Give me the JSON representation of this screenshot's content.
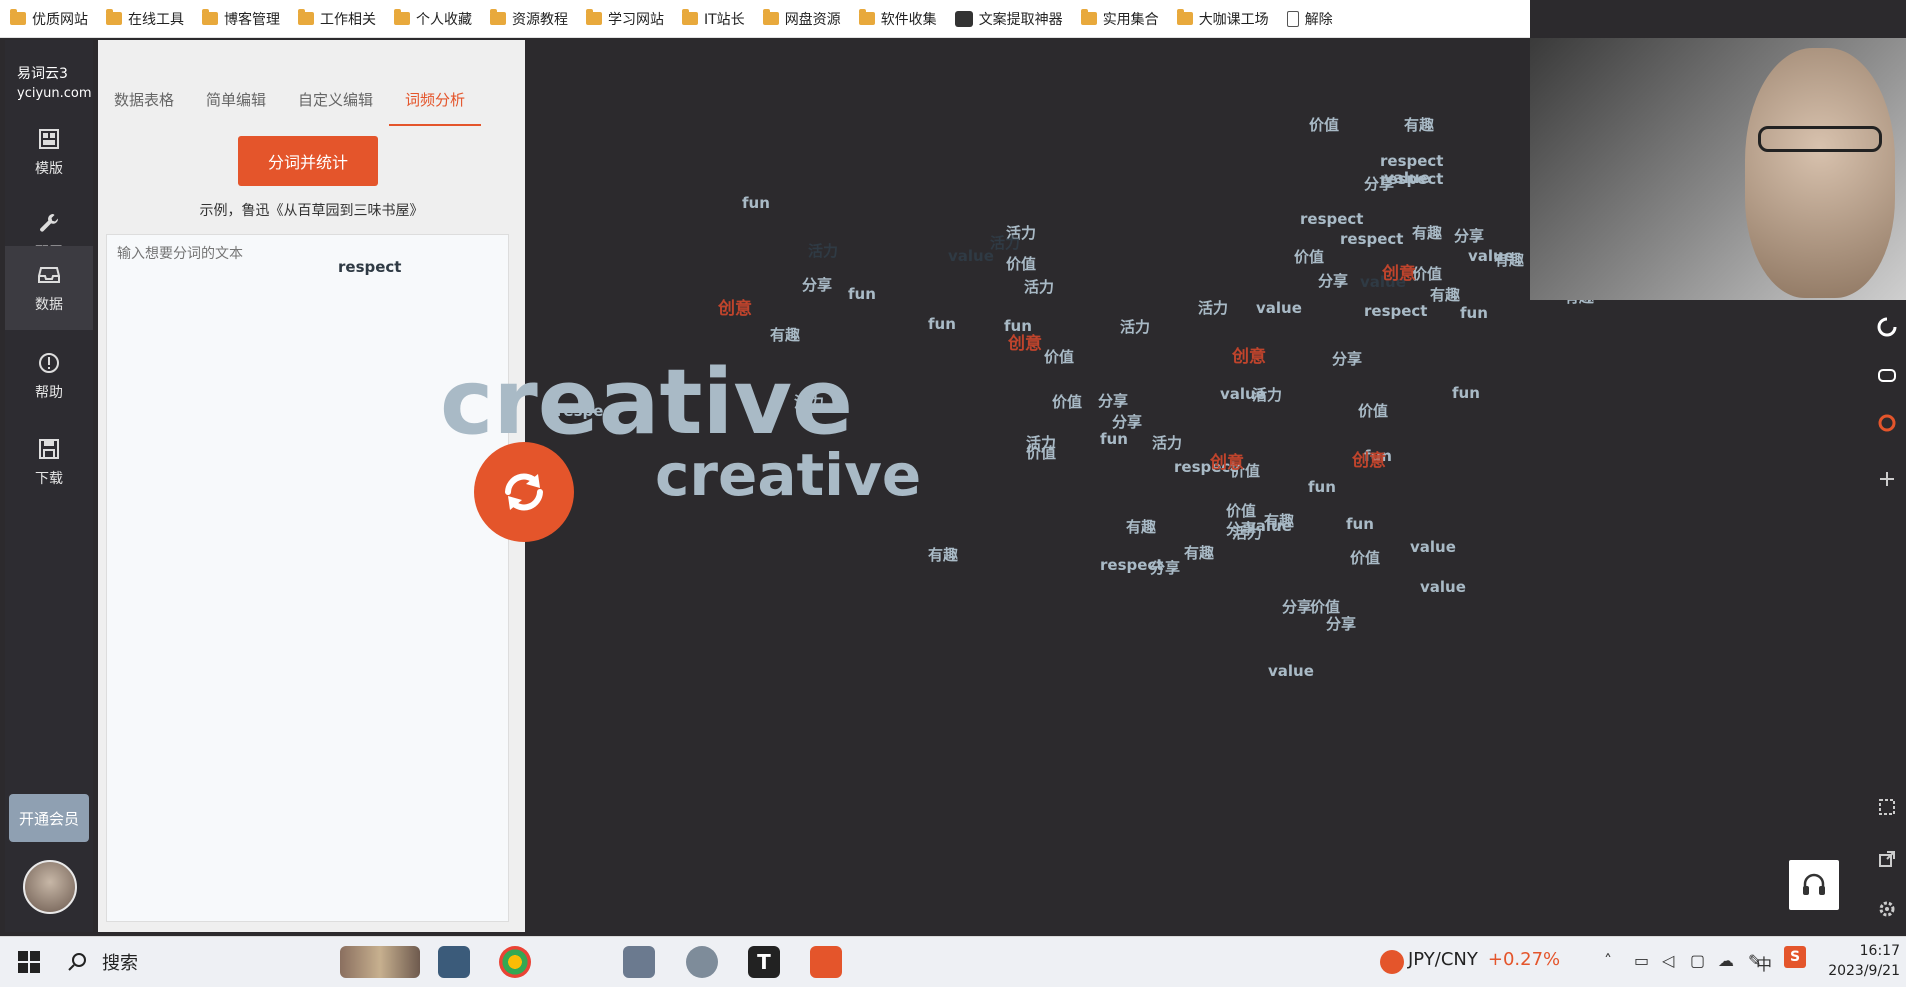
{
  "bookmarks": [
    "优质网站",
    "在线工具",
    "博客管理",
    "工作相关",
    "个人收藏",
    "资源教程",
    "学习网站",
    "IT站长",
    "网盘资源",
    "软件收集",
    "文案提取神器",
    "实用集合",
    "大咖课工场",
    "解除"
  ],
  "sidebar": {
    "brand_name": "易词云3",
    "brand_domain": "yciyun.com",
    "items": [
      {
        "label": "模版",
        "icon": "template-icon"
      },
      {
        "label": "配置",
        "icon": "wrench-icon"
      },
      {
        "label": "数据",
        "icon": "inbox-icon"
      },
      {
        "label": "帮助",
        "icon": "info-icon"
      },
      {
        "label": "下载",
        "icon": "save-icon"
      }
    ],
    "vip_label": "开通会员"
  },
  "panel": {
    "tabs": [
      "数据表格",
      "简单编辑",
      "自定义编辑",
      "词频分析"
    ],
    "active_tab": "词频分析",
    "segment_button": "分词并统计",
    "example_text": "示例，鲁迅《从百草园到三味书屋》",
    "input_placeholder": "输入想要分词的文本"
  },
  "wordcloud": {
    "colors": {
      "light": "#a9bac6",
      "dark": "#2f3a44",
      "red": "#c0442c"
    },
    "words": [
      "creative",
      "creative",
      "respect",
      "respect",
      "respect",
      "respect",
      "respect",
      "respect",
      "respect",
      "respect",
      "respect",
      "有趣",
      "有趣",
      "有趣",
      "有趣",
      "有趣",
      "有趣",
      "有趣",
      "有趣",
      "有趣",
      "有趣",
      "活力",
      "活力",
      "活力",
      "活力",
      "活力",
      "活力",
      "活力",
      "活力",
      "活力",
      "活力",
      "活力",
      "分享",
      "分享",
      "分享",
      "分享",
      "分享",
      "分享",
      "分享",
      "分享",
      "分享",
      "分享",
      "分享",
      "价值",
      "价值",
      "价值",
      "价值",
      "价值",
      "价值",
      "价值",
      "价值",
      "价值",
      "价值",
      "价值",
      "价值",
      "fun",
      "fun",
      "fun",
      "fun",
      "fun",
      "fun",
      "fun",
      "fun",
      "fun",
      "fun",
      "value",
      "value",
      "value",
      "value",
      "value",
      "value",
      "value",
      "value",
      "value",
      "value",
      "创意",
      "创意",
      "创意",
      "创意",
      "创意",
      "创意"
    ]
  },
  "taskbar": {
    "search_label": "搜索",
    "fx_pair": "JPY/CNY",
    "fx_change": "+0.27%",
    "ime": "中",
    "time": "16:17",
    "date": "2023/9/21"
  }
}
